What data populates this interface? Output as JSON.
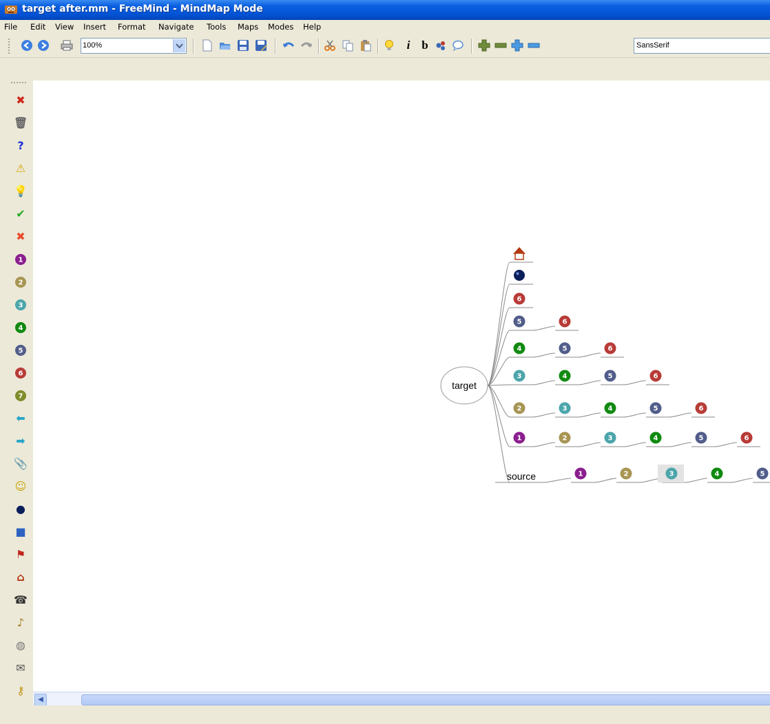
{
  "window": {
    "title": "target after.mm - FreeMind - MindMap Mode"
  },
  "menu": [
    "File",
    "Edit",
    "View",
    "Insert",
    "Format",
    "Navigate",
    "Tools",
    "Maps",
    "Modes",
    "Help"
  ],
  "toolbar": {
    "zoom_value": "100%",
    "font_value": "SansSerif",
    "icons": [
      "back-icon",
      "forward-icon",
      "print-icon",
      "new-icon",
      "open-icon",
      "save-icon",
      "save-as-icon",
      "undo-icon",
      "redo-icon",
      "cut-icon",
      "copy-icon",
      "paste-icon",
      "idea-icon",
      "italic-icon",
      "bold-icon",
      "cloud-icon",
      "note-icon",
      "increase-icon",
      "decrease-icon",
      "enlarge-icon",
      "shrink-icon"
    ],
    "italic_label": "i",
    "bold_label": "b"
  },
  "left_toolbar": {
    "icons": [
      "remove-last-icon",
      "remove-all-icon",
      "question-icon",
      "warning-icon",
      "idea-icon",
      "ok-icon",
      "cancel-icon",
      "priority-1-icon",
      "priority-2-icon",
      "priority-3-icon",
      "priority-4-icon",
      "priority-5-icon",
      "priority-6-icon",
      "priority-7-icon",
      "back-arrow-icon",
      "forward-arrow-icon",
      "attachment-icon",
      "smiley-icon",
      "bomb-icon",
      "book-icon",
      "flag-icon",
      "home-icon",
      "phone-icon",
      "music-icon",
      "mouse-icon",
      "mail-icon",
      "key-icon",
      "pen-icon"
    ]
  },
  "mindmap": {
    "root_label": "target",
    "source_label": "source",
    "colors": {
      "1": "#8b1f8f",
      "2": "#a89553",
      "3": "#4ca5ab",
      "4": "#118a11",
      "5": "#515d8a",
      "6": "#b83b37",
      "7": "#7f8c2a"
    },
    "rows": [
      {
        "items": [
          "home"
        ]
      },
      {
        "items": [
          "bomb"
        ]
      },
      {
        "items": [
          "6"
        ]
      },
      {
        "items": [
          "5",
          "6"
        ]
      },
      {
        "items": [
          "4",
          "5",
          "6"
        ]
      },
      {
        "items": [
          "3",
          "4",
          "5",
          "6"
        ]
      },
      {
        "items": [
          "2",
          "3",
          "4",
          "5",
          "6"
        ]
      },
      {
        "items": [
          "1",
          "2",
          "3",
          "4",
          "5",
          "6"
        ]
      },
      {
        "items": [
          "source",
          "1",
          "2",
          "3",
          "4",
          "5"
        ]
      }
    ]
  }
}
